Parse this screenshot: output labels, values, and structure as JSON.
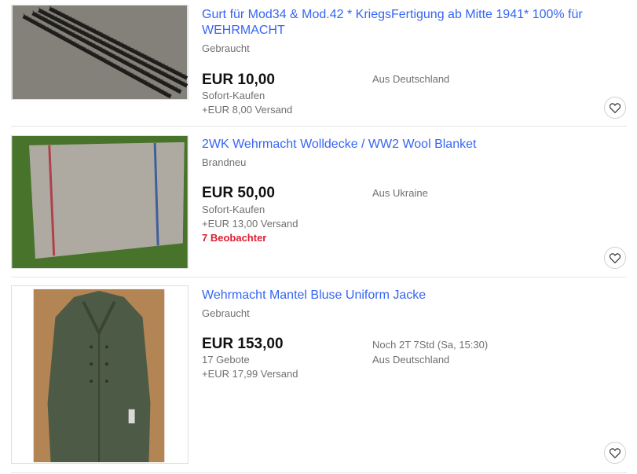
{
  "listings": [
    {
      "title": "Gurt für Mod34 & Mod.42 * KriegsFertigung ab Mitte 1941* 100% für WEHRMACHT",
      "condition": "Gebraucht",
      "price": "EUR 10,00",
      "buy_format": "Sofort-Kaufen",
      "shipping": "+EUR 8,00 Versand",
      "location": "Aus Deutschland",
      "image_icon": "ammo-belt-photo",
      "watch_icon": "heart-icon"
    },
    {
      "title": "2WK Wehrmacht Wolldecke / WW2 Wool Blanket",
      "condition": "Brandneu",
      "price": "EUR 50,00",
      "buy_format": "Sofort-Kaufen",
      "shipping": "+EUR 13,00 Versand",
      "location": "Aus Ukraine",
      "watchers": "7 Beobachter",
      "image_icon": "wool-blanket-photo",
      "watch_icon": "heart-icon"
    },
    {
      "title": "Wehrmacht Mantel Bluse Uniform Jacke",
      "condition": "Gebraucht",
      "price": "EUR 153,00",
      "bids": "17 Gebote",
      "shipping": "+EUR 17,99 Versand",
      "time_left": "Noch 2T 7Std (Sa, 15:30)",
      "location": "Aus Deutschland",
      "image_icon": "coat-photo",
      "watch_icon": "heart-icon"
    }
  ],
  "colors": {
    "link": "#3665f3",
    "price": "#111111",
    "secondary": "#707070",
    "watchers": "#dd1e31"
  }
}
